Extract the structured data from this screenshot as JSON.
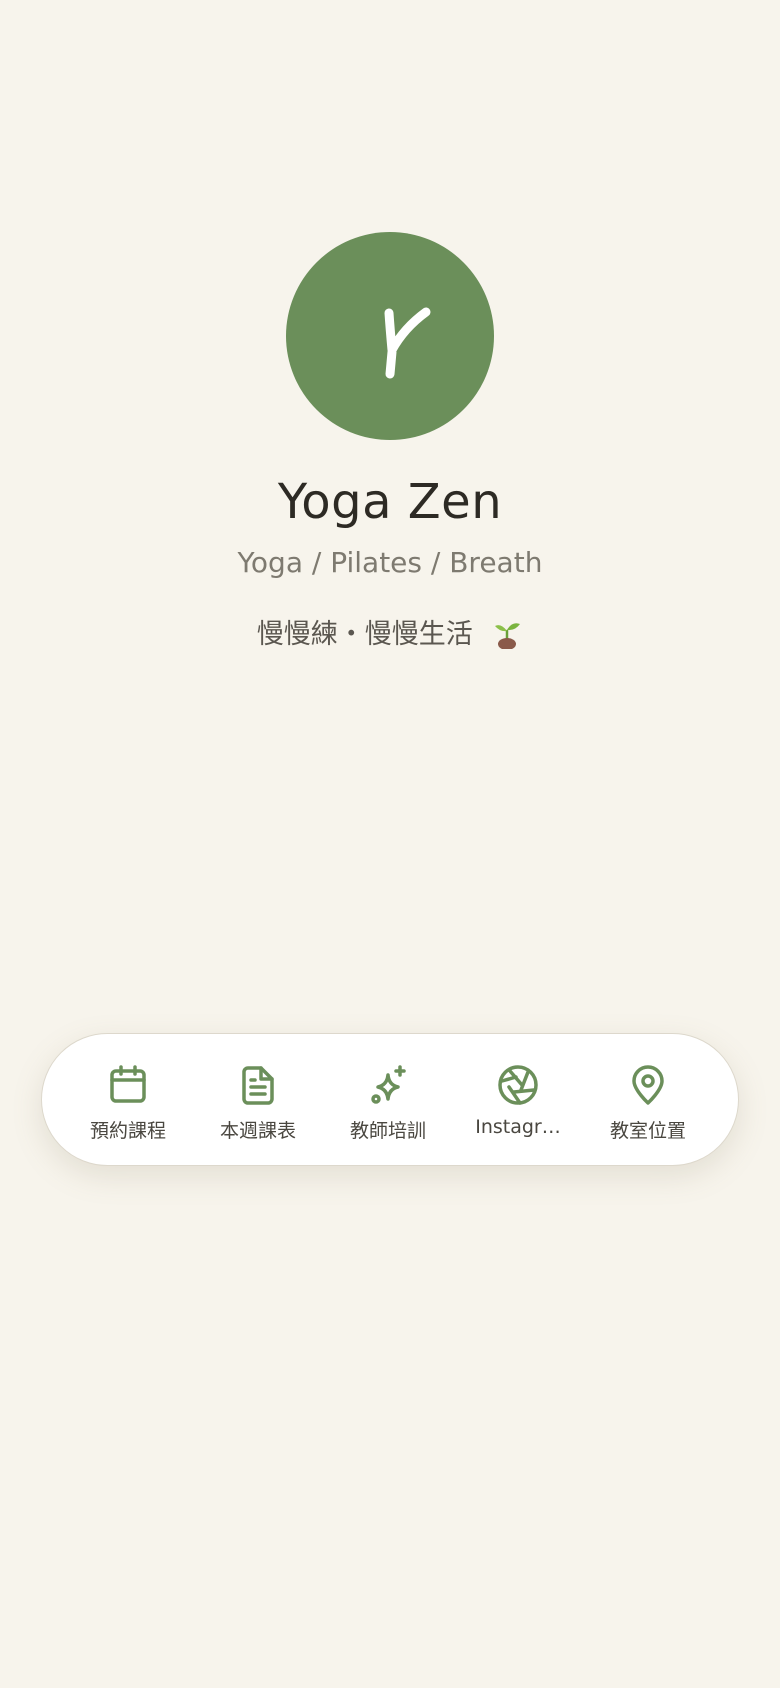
{
  "profile": {
    "avatar_letter": "Y",
    "name": "Yoga Zen",
    "tagline": "Yoga / Pilates / Breath",
    "motto": "慢慢練・慢慢生活"
  },
  "dock": {
    "items": [
      {
        "label": "預約課程",
        "icon": "calendar-icon"
      },
      {
        "label": "本週課表",
        "icon": "document-icon"
      },
      {
        "label": "教師培訓",
        "icon": "sparkle-icon"
      },
      {
        "label": "Instagr…",
        "icon": "aperture-icon"
      },
      {
        "label": "教室位置",
        "icon": "map-pin-icon"
      }
    ]
  },
  "colors": {
    "background": "#f7f4ec",
    "accent": "#6b8f5a",
    "dock_background": "#ffffff",
    "text_primary": "#2d2a24",
    "text_secondary": "#7e7a70"
  }
}
